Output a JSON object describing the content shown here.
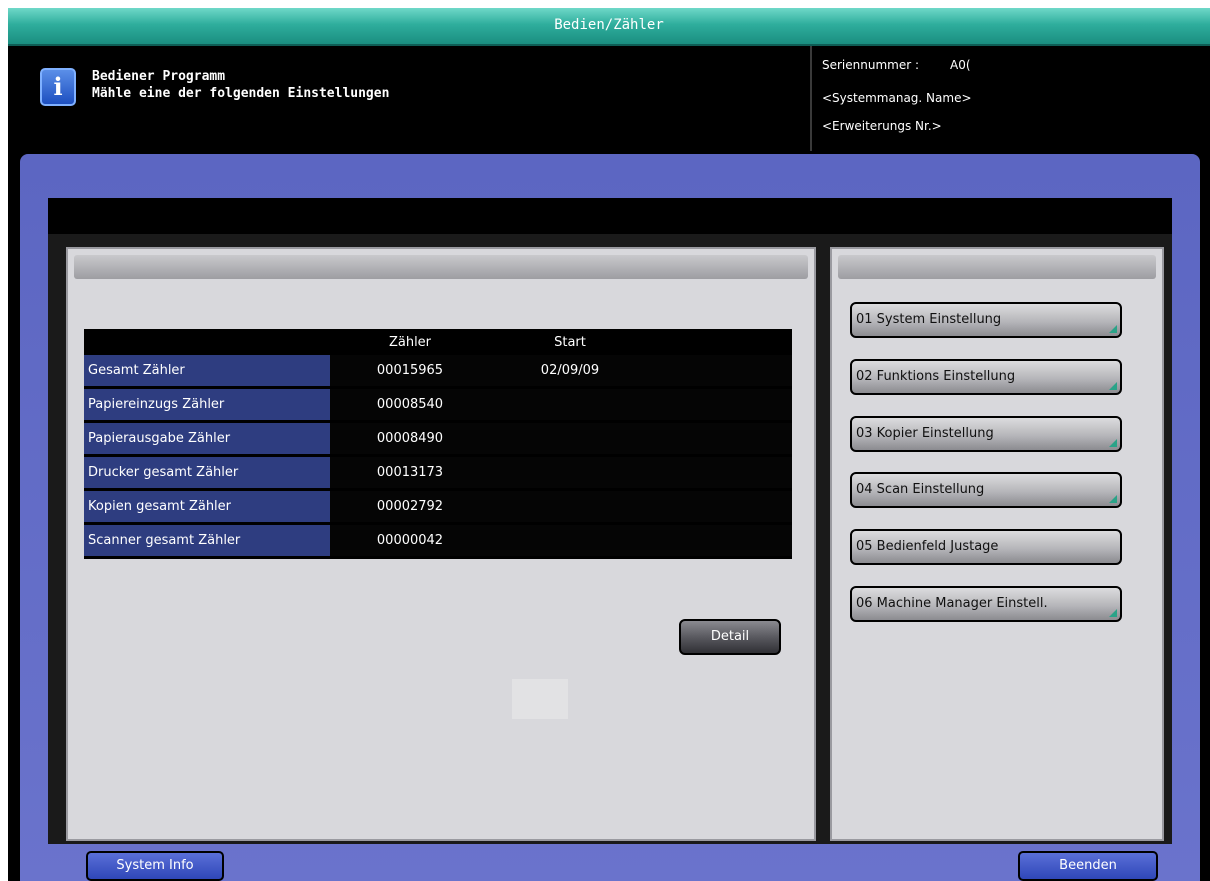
{
  "window": {
    "title": "Bedien/Zähler"
  },
  "message": {
    "line1": "Bediener Programm",
    "line2": "Mähle eine der folgenden Einstellungen",
    "icon": "info-icon"
  },
  "info": {
    "serial_label": "Seriennummer  :",
    "serial_value": "A0(",
    "system_name": "<Systemmanag. Name>",
    "extension_no": "<Erweiterungs Nr.>"
  },
  "counters": {
    "headers": {
      "value": "Zähler",
      "start": "Start"
    },
    "rows": [
      {
        "label": "Gesamt Zähler",
        "value": "00015965",
        "start": "02/09/09"
      },
      {
        "label": "Papiereinzugs Zähler",
        "value": "00008540",
        "start": ""
      },
      {
        "label": "Papierausgabe Zähler",
        "value": "00008490",
        "start": ""
      },
      {
        "label": "Drucker gesamt Zähler",
        "value": "00013173",
        "start": ""
      },
      {
        "label": "Kopien gesamt Zähler",
        "value": "00002792",
        "start": ""
      },
      {
        "label": "Scanner gesamt Zähler",
        "value": "00000042",
        "start": ""
      }
    ],
    "detail_button": "Detail"
  },
  "menu": {
    "items": [
      {
        "label": "01 System Einstellung"
      },
      {
        "label": "02 Funktions Einstellung"
      },
      {
        "label": "03 Kopier Einstellung"
      },
      {
        "label": "04 Scan Einstellung"
      },
      {
        "label": "05 Bedienfeld Justage"
      },
      {
        "label": "06 Machine Manager Einstell."
      }
    ]
  },
  "footer": {
    "system_info": "System Info",
    "exit": "Beenden"
  },
  "colors": {
    "titlebar": "#2fae9d",
    "frame": "#6a73cc",
    "label_cell": "#2e3d80",
    "bottom_button": "#2f47b8",
    "corner_mark": "#2aa388"
  }
}
